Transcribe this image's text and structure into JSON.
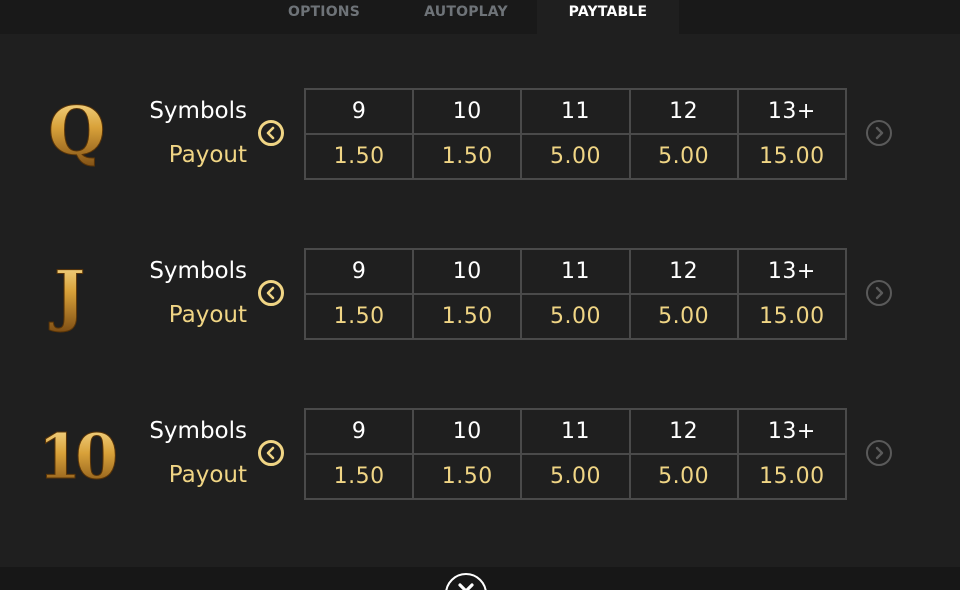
{
  "tabs": [
    {
      "label": "OPTIONS",
      "active": false
    },
    {
      "label": "AUTOPLAY",
      "active": false
    },
    {
      "label": "PAYTABLE",
      "active": true
    }
  ],
  "labels": {
    "symbols": "Symbols",
    "payout": "Payout"
  },
  "rows": [
    {
      "symbol": "Q",
      "symbol_icon": "letter-q-icon",
      "counts": [
        "9",
        "10",
        "11",
        "12",
        "13+"
      ],
      "payouts": [
        "1.50",
        "1.50",
        "5.00",
        "5.00",
        "15.00"
      ]
    },
    {
      "symbol": "J",
      "symbol_icon": "letter-j-icon",
      "counts": [
        "9",
        "10",
        "11",
        "12",
        "13+"
      ],
      "payouts": [
        "1.50",
        "1.50",
        "5.00",
        "5.00",
        "15.00"
      ]
    },
    {
      "symbol": "10",
      "symbol_icon": "number-ten-icon",
      "counts": [
        "9",
        "10",
        "11",
        "12",
        "13+"
      ],
      "payouts": [
        "1.50",
        "1.50",
        "5.00",
        "5.00",
        "15.00"
      ]
    }
  ],
  "colors": {
    "gold": "#f0d585",
    "background": "#1f1f1f",
    "tab_bar": "#191919",
    "inactive_tab": "#6e7378",
    "grid_border": "#4a4a4a"
  },
  "icons": {
    "prev": "chevron-left-circle-icon",
    "next": "chevron-right-circle-icon",
    "close": "close-icon"
  }
}
